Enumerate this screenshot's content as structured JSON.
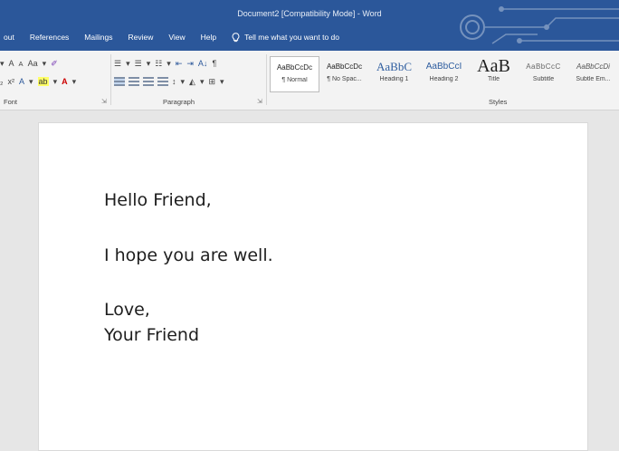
{
  "window": {
    "title": "Document2 [Compatibility Mode] - Word"
  },
  "tabs": [
    "out",
    "References",
    "Mailings",
    "Review",
    "View",
    "Help"
  ],
  "tell_me": {
    "text": "Tell me what you want to do"
  },
  "ribbon": {
    "font_group": {
      "label": "Font",
      "grow": "A",
      "shrink": "A",
      "change_case": "Aa",
      "subscript": "₂",
      "superscript": "x²",
      "text_effects": "A",
      "highlight": "ab",
      "font_color": "A"
    },
    "paragraph_group": {
      "label": "Paragraph",
      "pilcrow": "¶",
      "sort": "A↓"
    },
    "styles_group": {
      "label": "Styles",
      "items": [
        {
          "sample": "AaBbCcDc",
          "name": "¶ Normal",
          "selected": true
        },
        {
          "sample": "AaBbCcDc",
          "name": "¶ No Spac...",
          "selected": false
        },
        {
          "sample": "AaBbC",
          "name": "Heading 1",
          "selected": false
        },
        {
          "sample": "AaBbCcI",
          "name": "Heading 2",
          "selected": false
        },
        {
          "sample": "AaB",
          "name": "Title",
          "selected": false
        },
        {
          "sample": "AaBbCcC",
          "name": "Subtitle",
          "selected": false
        },
        {
          "sample": "AaBbCcDi",
          "name": "Subtle Em...",
          "selected": false
        }
      ]
    }
  },
  "document": {
    "paragraphs": [
      "Hello Friend,",
      "I hope you are well.",
      "Love,",
      "Your Friend"
    ]
  },
  "colors": {
    "accent": "#2b579a",
    "ribbon_bg": "#f3f3f3",
    "canvas_bg": "#e6e6e6"
  }
}
